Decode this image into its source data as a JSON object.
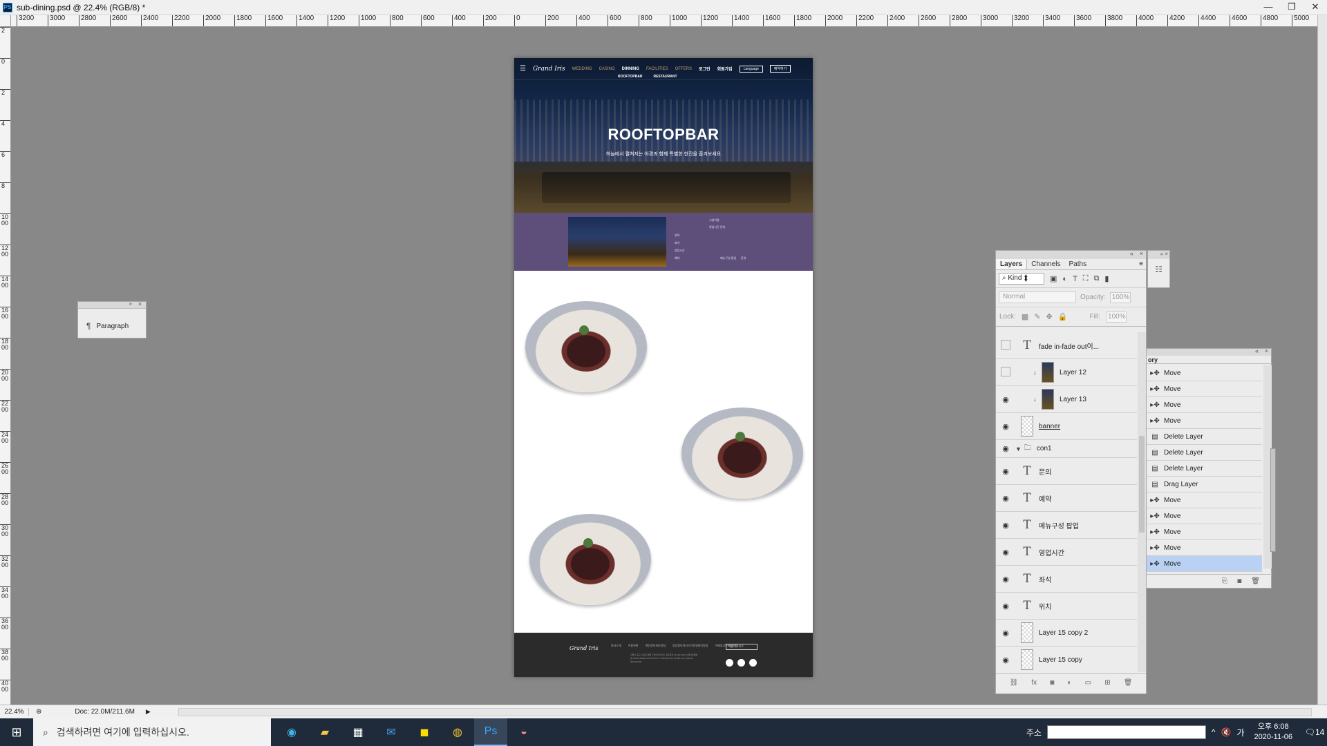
{
  "window": {
    "app_icon": "PS",
    "title": "sub-dining.psd @ 22.4% (RGB/8) *",
    "controls": [
      "—",
      "❐",
      "✕"
    ]
  },
  "ruler": {
    "h_labels": [
      "3200",
      "3000",
      "2800",
      "2600",
      "2400",
      "2200",
      "2000",
      "1800",
      "1600",
      "1400",
      "1200",
      "1000",
      "800",
      "600",
      "400",
      "200",
      "0",
      "200",
      "400",
      "600",
      "800",
      "1000",
      "1200",
      "1400",
      "1600",
      "1800",
      "2000",
      "2200",
      "2400",
      "2600",
      "2800",
      "3000",
      "3200",
      "3400",
      "3600",
      "3800",
      "4000",
      "4200",
      "4400",
      "4600",
      "4800",
      "5000"
    ],
    "v_labels": [
      "2",
      "0",
      "2",
      "4",
      "6",
      "8",
      "1000",
      "1200",
      "1400",
      "1600",
      "1800",
      "2000",
      "2200",
      "2400",
      "2600",
      "2800",
      "3000",
      "3200",
      "3400",
      "3600",
      "3800",
      "4000"
    ]
  },
  "document": {
    "hero": {
      "logo": "Grand Iris",
      "nav": [
        "WEDDING",
        "CASINO",
        "DINNING",
        "FACILITIES",
        "OFFERS"
      ],
      "active_nav": "DINNING",
      "right_links": [
        "로그인",
        "회원가입"
      ],
      "buttons": [
        "Language",
        "예약하기"
      ],
      "sub_nav": [
        "ROOFTOPBAR",
        "RESTAURANT"
      ],
      "title": "ROOFTOPBAR",
      "subtitle": "하늘에서 펼쳐지는 야경과 함께 특별한 한잔을 즐겨보세요"
    },
    "purple": {
      "heading": "시설이용",
      "subheading": "영업시간 안내",
      "items": [
        "위치",
        "좌석",
        "영업시간",
        "예약"
      ],
      "footer_links": [
        "메뉴구성 팝업",
        "문의"
      ]
    },
    "footer": {
      "logo": "Grand Iris",
      "links": [
        "회사소개",
        "이용약관",
        "개인정보처리방침",
        "영상정보처리기기운영관리방침",
        "이메일무단수집거부"
      ],
      "info": "서울시 중구 소공로 호텔 그랜드아이리스 대표전화 02-000-0000 사업자등록번호 000-00-00000 COPYRIGHT © GRAND IRIS HOTEL ALL RIGHTS RESERVED",
      "family_site": "패밀리사이트"
    }
  },
  "paragraph_panel": {
    "icon": "¶",
    "label": "Paragraph"
  },
  "history_panel": {
    "tab": "ory",
    "items": [
      {
        "icon": "move-icon",
        "label": "Move",
        "selected": false
      },
      {
        "icon": "move-icon",
        "label": "Move",
        "selected": false
      },
      {
        "icon": "move-icon",
        "label": "Move",
        "selected": false
      },
      {
        "icon": "move-icon",
        "label": "Move",
        "selected": false
      },
      {
        "icon": "delete-layer-icon",
        "label": "Delete Layer",
        "selected": false
      },
      {
        "icon": "delete-layer-icon",
        "label": "Delete Layer",
        "selected": false
      },
      {
        "icon": "delete-layer-icon",
        "label": "Delete Layer",
        "selected": false
      },
      {
        "icon": "drag-layer-icon",
        "label": "Drag Layer",
        "selected": false
      },
      {
        "icon": "move-icon",
        "label": "Move",
        "selected": false
      },
      {
        "icon": "move-icon",
        "label": "Move",
        "selected": false
      },
      {
        "icon": "move-icon",
        "label": "Move",
        "selected": false
      },
      {
        "icon": "move-icon",
        "label": "Move",
        "selected": false
      },
      {
        "icon": "move-icon",
        "label": "Move",
        "selected": true
      }
    ]
  },
  "layers_panel": {
    "tabs": [
      "Layers",
      "Channels",
      "Paths"
    ],
    "active_tab": "Layers",
    "filter": "Kind",
    "blend_mode": "Normal",
    "opacity_label": "Opacity:",
    "opacity": "100%",
    "lock_label": "Lock:",
    "fill_label": "Fill:",
    "fill": "100%",
    "layers": [
      {
        "name": "fade in-fade out이...",
        "kind": "text",
        "visible": false
      },
      {
        "name": "Layer 12",
        "kind": "image",
        "visible": false,
        "clipped": true
      },
      {
        "name": "Layer 13",
        "kind": "image",
        "visible": true,
        "clipped": true
      },
      {
        "name": "banner",
        "kind": "image",
        "visible": true,
        "underline": true
      },
      {
        "name": "con1",
        "kind": "group",
        "visible": true
      },
      {
        "name": "문의",
        "kind": "text",
        "visible": true
      },
      {
        "name": "예약",
        "kind": "text",
        "visible": true
      },
      {
        "name": "메뉴구성 팝업",
        "kind": "text",
        "visible": true
      },
      {
        "name": "영업시간",
        "kind": "text",
        "visible": true
      },
      {
        "name": "좌석",
        "kind": "text",
        "visible": true
      },
      {
        "name": "위치",
        "kind": "text",
        "visible": true
      },
      {
        "name": "Layer 15 copy 2",
        "kind": "image",
        "visible": true
      },
      {
        "name": "Layer 15 copy",
        "kind": "image",
        "visible": true
      }
    ]
  },
  "statusbar": {
    "zoom": "22.4%",
    "doc": "Doc: 22.0M/211.6M"
  },
  "taskbar": {
    "search_placeholder": "검색하려면 여기에 입력하십시오.",
    "address_label": "주소",
    "time": "오후 6:08",
    "date": "2020-11-06",
    "ime": "가",
    "notifications": "14"
  }
}
